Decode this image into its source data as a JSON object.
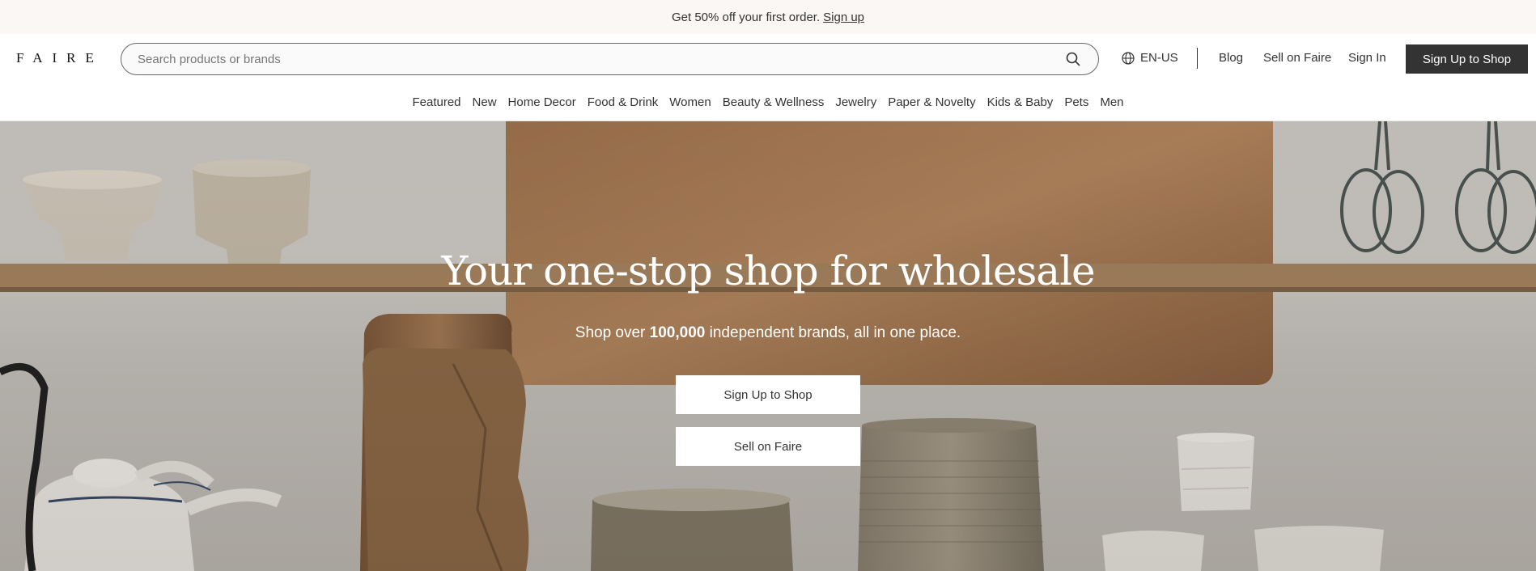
{
  "promo": {
    "text": "Get 50% off your first order.",
    "link": "Sign up"
  },
  "header": {
    "logo": "FAIRE",
    "search_placeholder": "Search products or brands",
    "search_icon": "search-icon",
    "language": "EN-US",
    "language_icon": "globe-icon",
    "blog": "Blog",
    "sell": "Sell on Faire",
    "sign_in": "Sign In",
    "cta": "Sign Up to Shop"
  },
  "categories": [
    "Featured",
    "New",
    "Home Decor",
    "Food & Drink",
    "Women",
    "Beauty & Wellness",
    "Jewelry",
    "Paper & Novelty",
    "Kids & Baby",
    "Pets",
    "Men"
  ],
  "hero": {
    "title": "Your one-stop shop for wholesale",
    "sub_pre": "Shop over",
    "sub_bold": "100,000",
    "sub_post": "independent brands, all in one place.",
    "btn_shop": "Sign Up to Shop",
    "btn_sell": "Sell on Faire"
  },
  "colors": {
    "promo_bg": "#faf7f4",
    "cta_bg": "#333333",
    "text": "#333333"
  }
}
